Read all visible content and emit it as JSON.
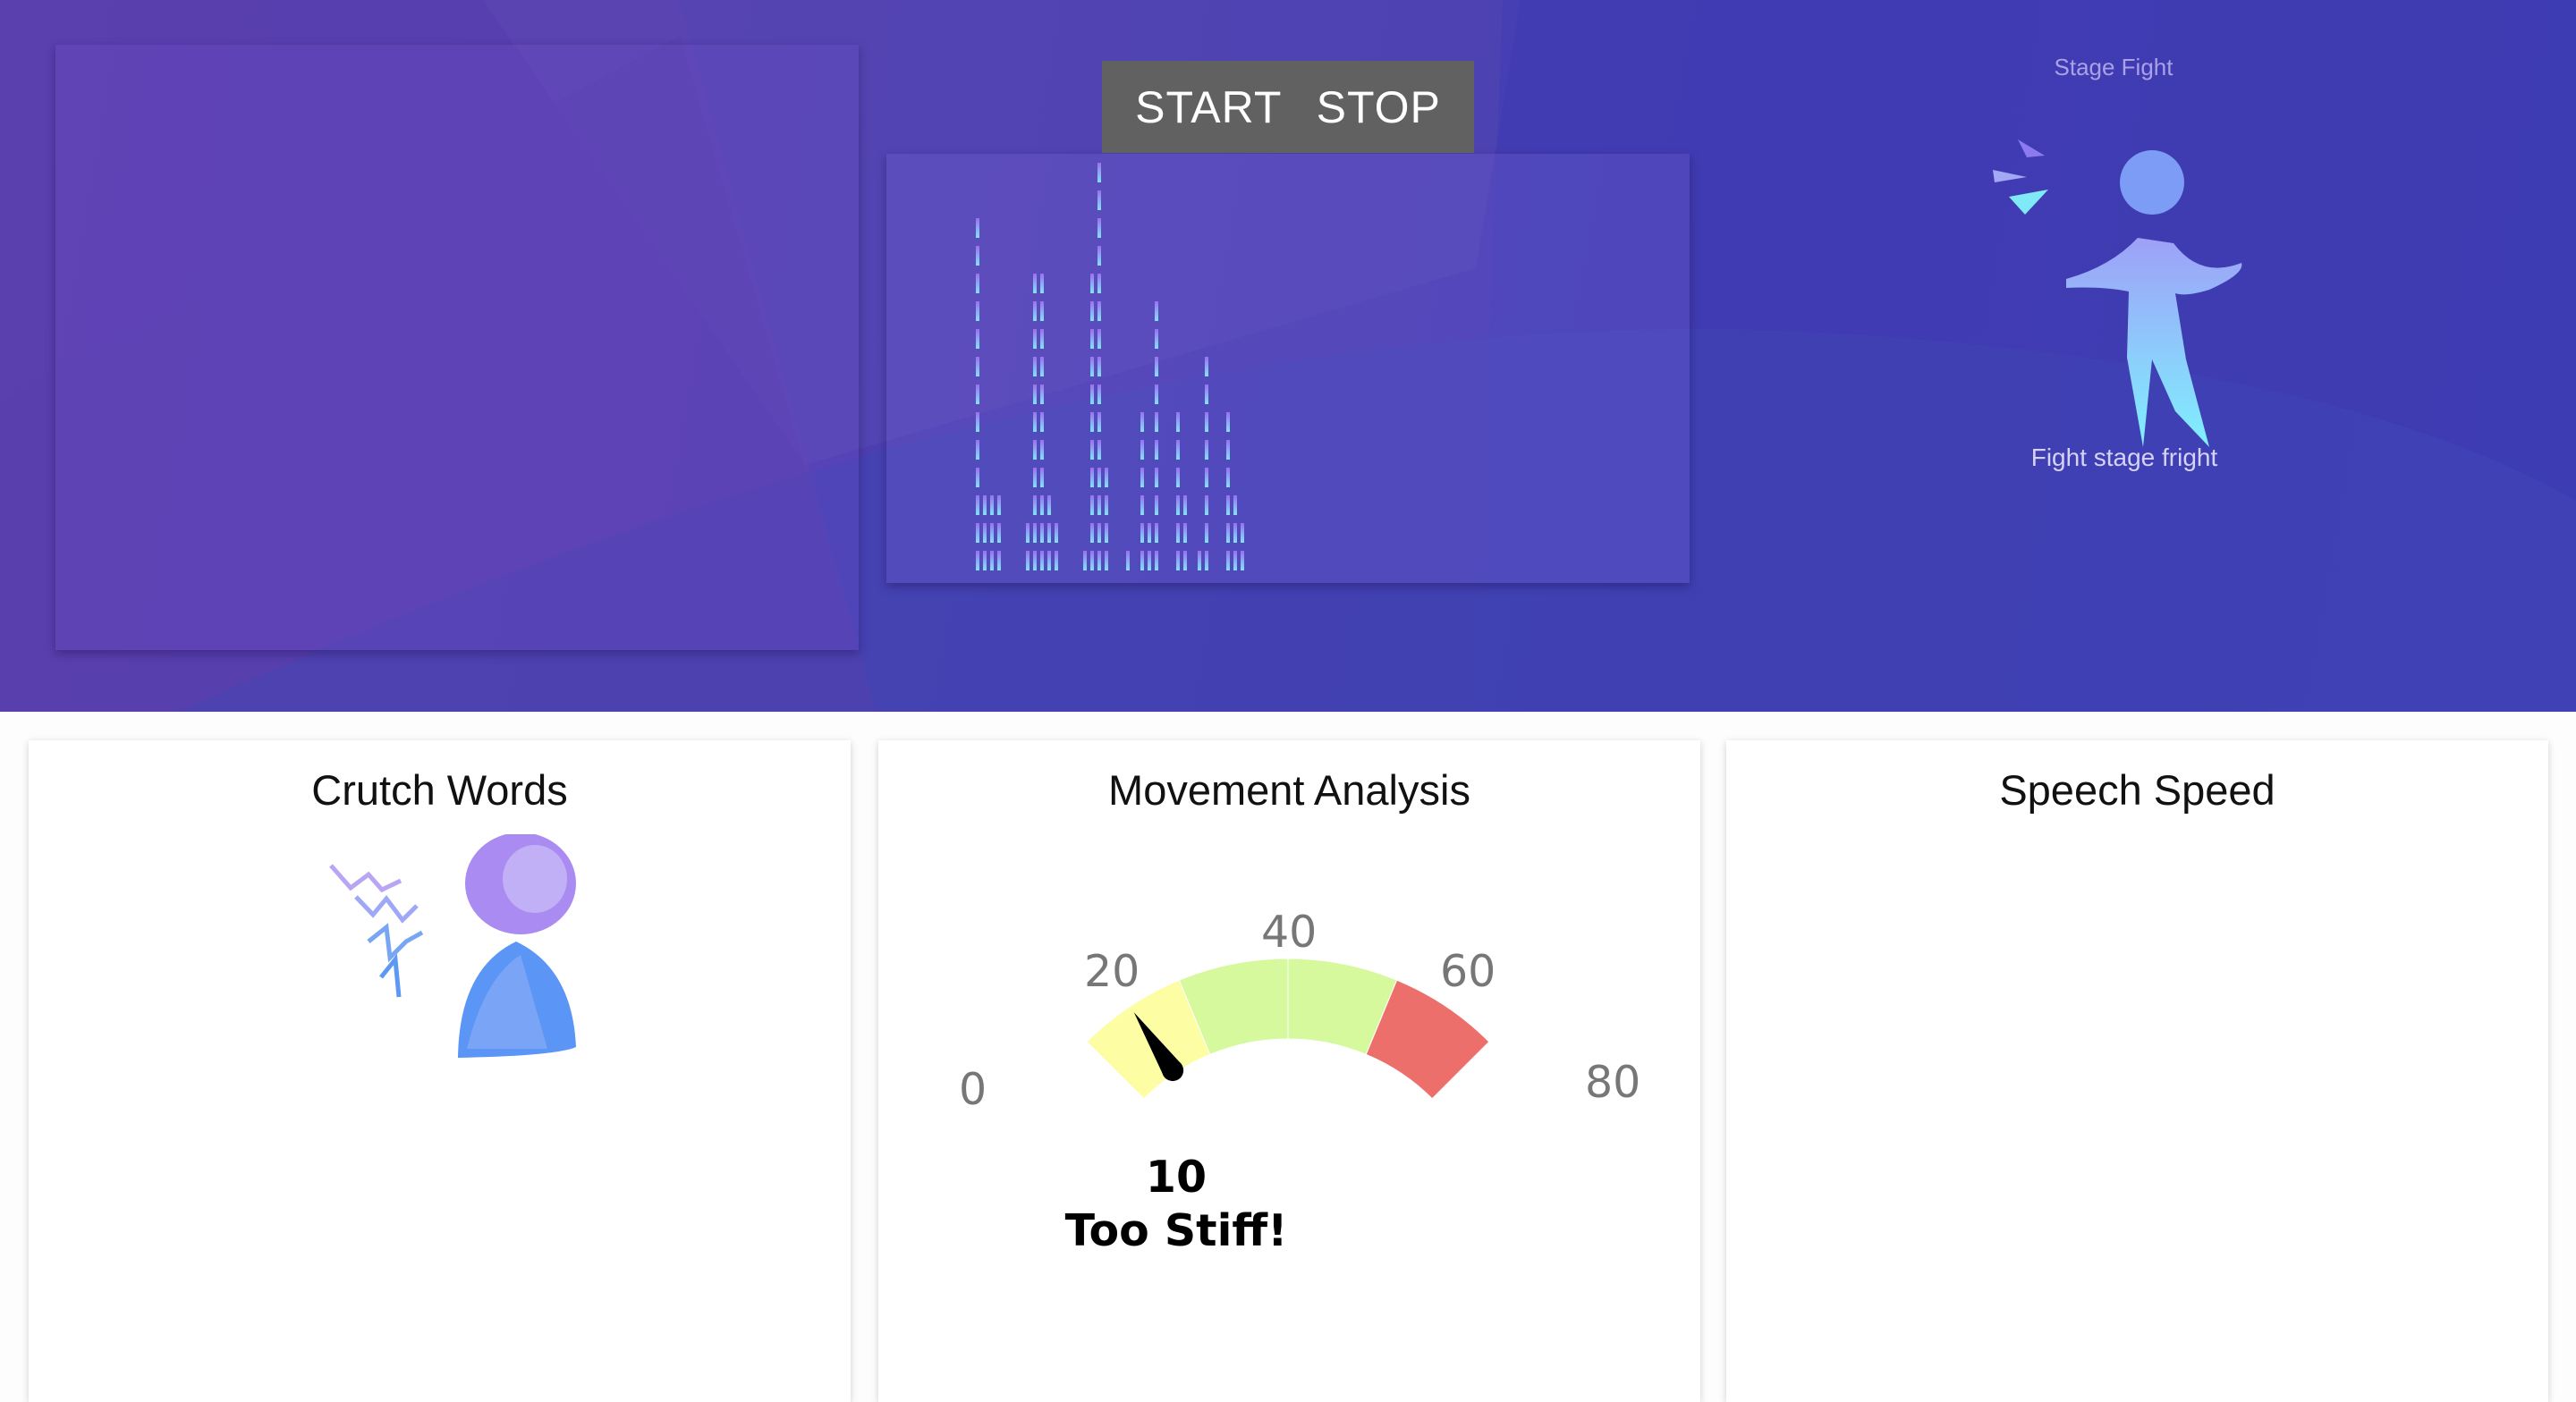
{
  "controls": {
    "start_label": "START",
    "stop_label": "STOP"
  },
  "brand": {
    "title": "Stage Fight",
    "tagline": "Fight stage fright"
  },
  "cards": {
    "crutch_words": {
      "title": "Crutch Words"
    },
    "movement": {
      "title": "Movement Analysis"
    },
    "speech_speed": {
      "title": "Speech Speed"
    }
  },
  "gauge": {
    "value": "10",
    "numeric_value": 10,
    "status": "Too Stiff!",
    "min": 0,
    "max": 80,
    "tick_labels": [
      "0",
      "20",
      "40",
      "60",
      "80"
    ],
    "bands": [
      {
        "from": 0,
        "to": 20,
        "color": "#fdfda3"
      },
      {
        "from": 20,
        "to": 40,
        "color": "#d7f99d"
      },
      {
        "from": 40,
        "to": 60,
        "color": "#d7f99d"
      },
      {
        "from": 60,
        "to": 80,
        "color": "#ec6f6b"
      }
    ],
    "needle_color": "#000000"
  },
  "audio_visualizer": {
    "levels": [
      13,
      3,
      3,
      3,
      0,
      2,
      11,
      11,
      3,
      2,
      0,
      1,
      11,
      15,
      4,
      1,
      0,
      6,
      2,
      10,
      6,
      3,
      0,
      1,
      8,
      6,
      3,
      2
    ]
  },
  "colors": {
    "hero_top": "#5a3fae",
    "hero_bottom": "#3f3cb2",
    "control_bar": "#616161",
    "bar_top": "#9a6fef",
    "bar_bottom": "#7fe4f7"
  }
}
